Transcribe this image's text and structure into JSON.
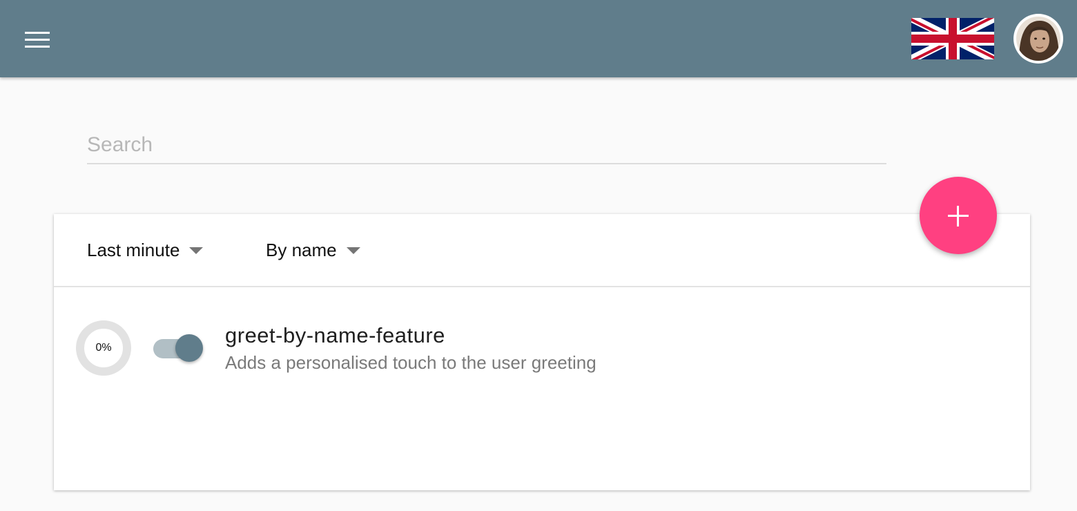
{
  "search": {
    "placeholder": "Search",
    "value": ""
  },
  "filters": {
    "time_label": "Last minute",
    "sort_label": "By name"
  },
  "features": [
    {
      "name": "greet-by-name-feature",
      "description": "Adds a personalised touch to the user greeting",
      "progress_text": "0%",
      "progress_fraction": 0,
      "enabled": true
    }
  ],
  "icons": {
    "menu": "menu-icon",
    "language": "uk-flag-icon",
    "avatar": "user-avatar",
    "add": "plus-icon",
    "dropdown": "chevron-down-icon"
  },
  "colors": {
    "appbar": "#607d8b",
    "accent": "#ff4081",
    "toggle_thumb": "#607d8b",
    "toggle_track": "#b1bfc5",
    "background": "#fafafa"
  }
}
